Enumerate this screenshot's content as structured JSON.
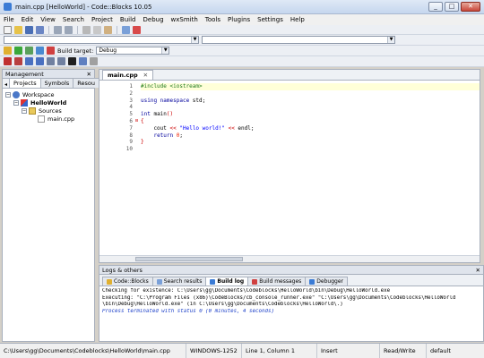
{
  "window": {
    "title": "main.cpp [HelloWorld] - Code::Blocks 10.05",
    "buttons": [
      "_",
      "□",
      "✕"
    ]
  },
  "menu": [
    "File",
    "Edit",
    "View",
    "Search",
    "Project",
    "Build",
    "Debug",
    "wxSmith",
    "Tools",
    "Plugins",
    "Settings",
    "Help"
  ],
  "toolbar": {
    "build_target_label": "Build target:",
    "build_target_value": "Debug"
  },
  "management": {
    "title": "Management",
    "close": "✕",
    "tabs": [
      "Projects",
      "Symbols",
      "Resou"
    ],
    "tree": {
      "workspace": "Workspace",
      "project": "HelloWorld",
      "folder": "Sources",
      "file": "main.cpp"
    }
  },
  "editor": {
    "tab": "main.cpp",
    "tab_close": "✕",
    "line_numbers": [
      "1",
      "2",
      "3",
      "4",
      "5",
      "6",
      "7",
      "8",
      "9",
      "10"
    ]
  },
  "logs": {
    "title": "Logs & others",
    "close": "✕",
    "tabs": [
      "Code::Blocks",
      "Search results",
      "Build log",
      "Build messages",
      "Debugger"
    ],
    "active_tab": "Build log",
    "lines": [
      "Checking for existence: C:\\Users\\gg\\Documents\\Codeblocks\\HelloWorld\\bin\\Debug\\HelloWorld.exe",
      "Executing: \"C:\\Program Files (x86)\\CodeBlocks/cb_console_runner.exe\" \"C:\\Users\\gg\\Documents\\Codeblocks\\HelloWorld",
      "\\bin\\Debug\\HelloWorld.exe\"  (in C:\\Users\\gg\\Documents\\Codeblocks\\HelloWorld\\.)",
      "Process terminated with status 0 (0 minutes, 4 seconds)"
    ]
  },
  "status": {
    "path": "C:\\Users\\gg\\Documents\\Codeblocks\\HelloWorld\\main.cpp",
    "encoding": "WINDOWS-1252",
    "position": "Line 1, Column 1",
    "mode": "Insert",
    "access": "Read/Write",
    "profile": "default"
  },
  "colors": {
    "accent": "#3a7bd5",
    "keyword": "#00009c",
    "preprocessor": "#1f7a1f",
    "string": "#0000ff",
    "operator": "#cc0000"
  }
}
